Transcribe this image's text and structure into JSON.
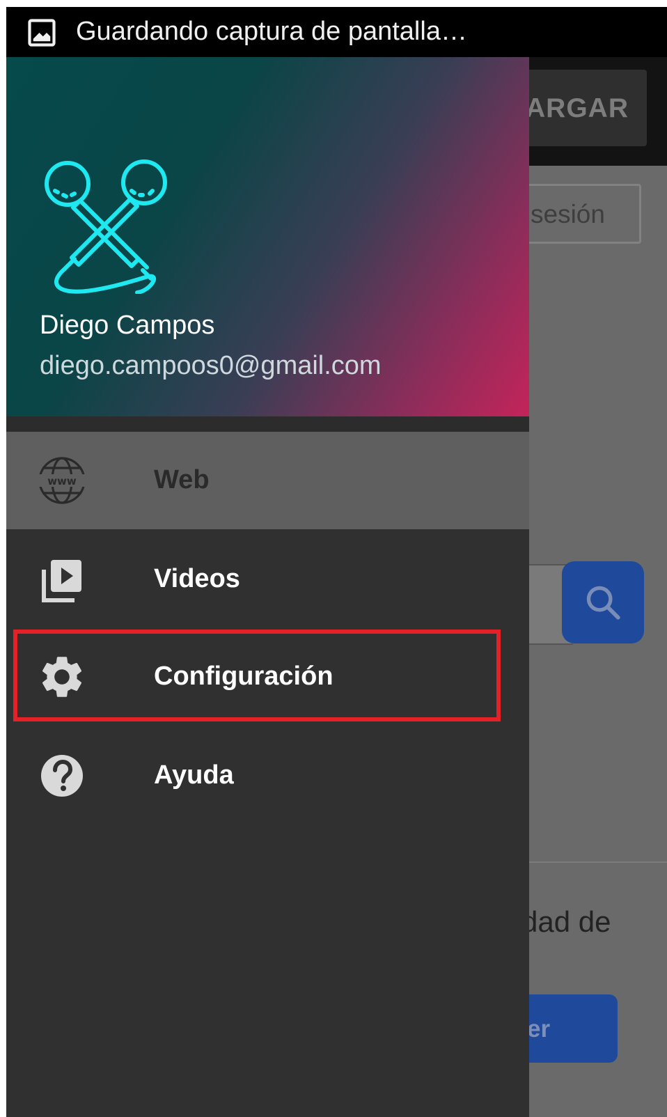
{
  "status_bar": {
    "text": "Guardando captura de pantalla…",
    "icon": "image-icon"
  },
  "background_app": {
    "download_label": "ARGAR",
    "session_label": "sesión",
    "text_fragment": "dad de",
    "button_label": "er",
    "search_icon": "search-icon"
  },
  "drawer": {
    "header": {
      "logo_icon": "crossed-microphones-icon",
      "user_name": "Diego Campos",
      "user_email": "diego.campoos0@gmail.com",
      "gradient_colors": [
        "#064a4c",
        "#3a3e55",
        "#c4245a"
      ]
    },
    "items": [
      {
        "label": "Web",
        "icon": "globe-www-icon",
        "selected": true
      },
      {
        "label": "Videos",
        "icon": "video-library-icon",
        "selected": false
      },
      {
        "label": "Configuración",
        "icon": "gear-icon",
        "selected": false,
        "highlighted": true
      },
      {
        "label": "Ayuda",
        "icon": "help-circle-icon",
        "selected": false
      }
    ]
  },
  "colors": {
    "highlight": "#e52026",
    "logo_accent": "#1ee8f0",
    "primary_blue": "#1f4a9b"
  }
}
